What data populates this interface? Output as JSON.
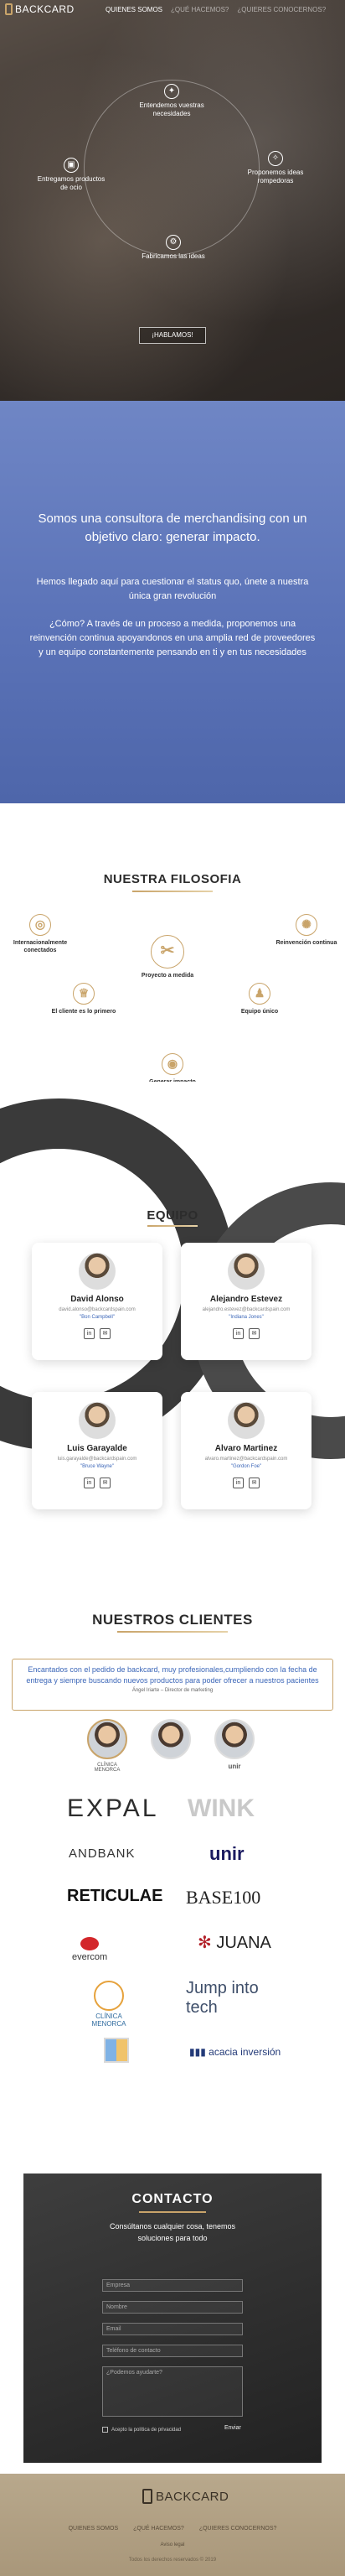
{
  "nav": {
    "logo": "BACKCARD",
    "links": [
      "QUIENES SOMOS",
      "¿QUÉ HACEMOS?",
      "¿QUIERES CONOCERNOS?"
    ]
  },
  "hero": {
    "steps": {
      "top": "Entendemos vuestras necesidades",
      "right": "Proponemos ideas rompedoras",
      "bottom": "Fabricamos las ideas",
      "left": "Entregamos productos de ocio"
    },
    "cta": "¡HABLAMOS!"
  },
  "about": {
    "headline": "Somos una consultora de merchandising con un objetivo claro: generar impacto.",
    "p1": "Hemos llegado aquí para cuestionar el status quo, únete a nuestra única gran revolución",
    "p2": "¿Cómo? A través de un proceso a medida, proponemos una reinvención continua apoyandonos en una amplia red de proveedores y un equipo constantemente pensando en ti y en tus necesidades"
  },
  "filosofia": {
    "title": "NUESTRA FILOSOFIA",
    "items": [
      "Internacionalmente conectados",
      "Reinvención continua",
      "Proyecto a medida",
      "El cliente es lo primero",
      "Equipo único",
      "Generar impacto"
    ]
  },
  "equipo": {
    "title": "EQUIPO",
    "members": [
      {
        "name": "David Alonso",
        "email": "david.alonso@backcardspain.com",
        "quote": "\"Bon Campbell\""
      },
      {
        "name": "Alejandro Estevez",
        "email": "alejandro.estevez@backcardspain.com",
        "quote": "\"Indiana Jones\""
      },
      {
        "name": "Luis Garayalde",
        "email": "luis.garayalde@backcardspain.com",
        "quote": "\"Bruce Wayne\""
      },
      {
        "name": "Alvaro Martinez",
        "email": "alvaro.martinez@backcardspain.com",
        "quote": "\"Gordon Foe\""
      }
    ]
  },
  "clientes": {
    "title": "NUESTROS CLIENTES",
    "testimonial": "Encantados con el pedido de backcard, muy profesionales,cumpliendo con la fecha de entrega y siempre buscando nuevos productos para poder ofrecer a nuestros pacientes",
    "author": "Ángel Iriarte – Director de marketing",
    "avatar_captions": [
      "CLÍNICA MENORCA",
      "",
      "unir"
    ],
    "logos": [
      "EXPAL",
      "WINK",
      "ANDBANK",
      "unir",
      "RETICULAE",
      "BASE100",
      "evercom",
      "JUANA",
      "CLÍNICA MENORCA",
      "Jump into tech",
      "",
      "acacia inversión"
    ]
  },
  "contacto": {
    "title": "CONTACTO",
    "sub": "Consúltanos cualquier cosa, tenemos soluciones para todo",
    "fields": [
      "Empresa",
      "Nombre",
      "Email",
      "Teléfono de contacto",
      "¿Podemos ayudarte?"
    ],
    "privacy": "Acepto la política de privacidad",
    "send": "Enviar"
  },
  "footer": {
    "logo": "BACKCARD",
    "links": [
      "QUIENES SOMOS",
      "¿QUÉ HACEMOS?",
      "¿QUIERES CONOCERNOS?"
    ],
    "legal": "Aviso legal",
    "copyright": "Todos los derechos reservados © 2019"
  },
  "colors": {
    "gold": "#c9a46a",
    "blue": "#5b73b8",
    "link": "#3b66b8"
  }
}
